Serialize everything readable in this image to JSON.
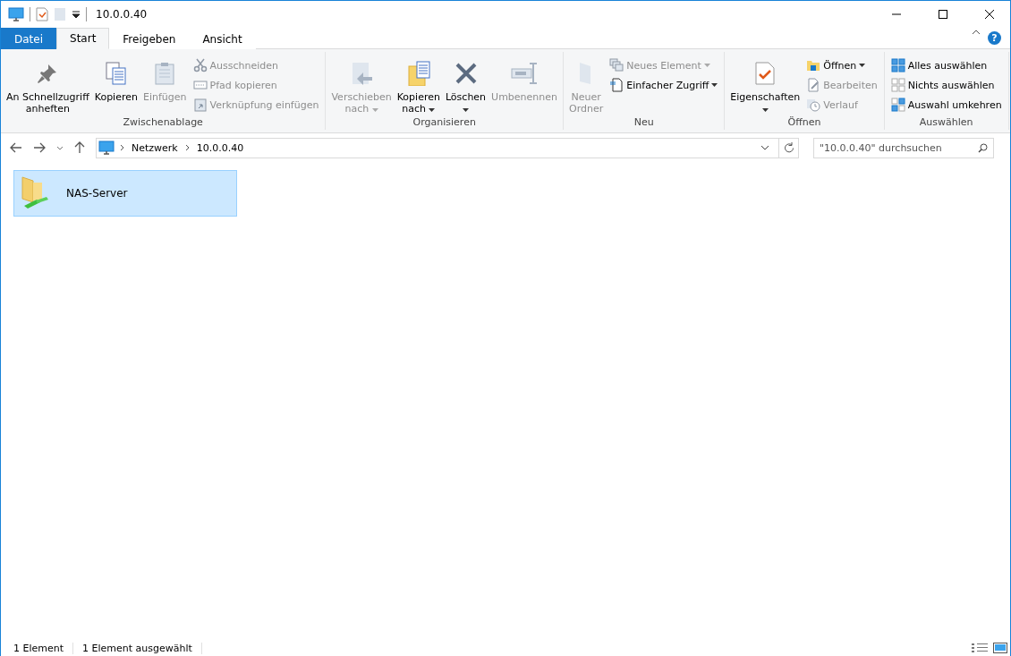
{
  "window": {
    "title": "10.0.0.40"
  },
  "tabs": [
    {
      "label": "Datei",
      "kind": "file",
      "selected": false
    },
    {
      "label": "Start",
      "kind": "tab",
      "selected": true
    },
    {
      "label": "Freigeben",
      "kind": "tab",
      "selected": false
    },
    {
      "label": "Ansicht",
      "kind": "tab",
      "selected": false
    }
  ],
  "help": "?",
  "ribbon": [
    {
      "label": "Zwischenablage",
      "items": [
        {
          "kind": "large",
          "lines": [
            "An Schnellzugriff",
            "anheften"
          ],
          "disabled": false,
          "dropdown": false
        },
        {
          "kind": "large",
          "lines": [
            "Kopieren"
          ],
          "disabled": false,
          "dropdown": false
        },
        {
          "kind": "large",
          "lines": [
            "Einfügen"
          ],
          "disabled": true,
          "dropdown": false
        },
        {
          "kind": "stack",
          "items": [
            {
              "label": "Ausschneiden",
              "disabled": true,
              "dropdown": false
            },
            {
              "label": "Pfad kopieren",
              "disabled": true,
              "dropdown": false
            },
            {
              "label": "Verknüpfung einfügen",
              "disabled": true,
              "dropdown": false
            }
          ]
        }
      ]
    },
    {
      "label": "Organisieren",
      "items": [
        {
          "kind": "large",
          "lines": [
            "Verschieben",
            "nach"
          ],
          "disabled": true,
          "dropdown": true
        },
        {
          "kind": "large",
          "lines": [
            "Kopieren",
            "nach"
          ],
          "disabled": false,
          "dropdown": true
        },
        {
          "kind": "large",
          "lines": [
            "Löschen"
          ],
          "disabled": false,
          "dropdown": true
        },
        {
          "kind": "large",
          "lines": [
            "Umbenennen"
          ],
          "disabled": true,
          "dropdown": false
        }
      ]
    },
    {
      "label": "Neu",
      "items": [
        {
          "kind": "large",
          "lines": [
            "Neuer",
            "Ordner"
          ],
          "disabled": true,
          "dropdown": false
        },
        {
          "kind": "stack",
          "items": [
            {
              "label": "Neues Element",
              "disabled": true,
              "dropdown": true
            },
            {
              "label": "Einfacher Zugriff",
              "disabled": false,
              "dropdown": true
            }
          ]
        }
      ]
    },
    {
      "label": "Öffnen",
      "items": [
        {
          "kind": "large",
          "lines": [
            "Eigenschaften"
          ],
          "disabled": false,
          "dropdown": true
        },
        {
          "kind": "stack",
          "items": [
            {
              "label": "Öffnen",
              "disabled": false,
              "dropdown": true
            },
            {
              "label": "Bearbeiten",
              "disabled": true,
              "dropdown": false
            },
            {
              "label": "Verlauf",
              "disabled": true,
              "dropdown": false
            }
          ]
        }
      ]
    },
    {
      "label": "Auswählen",
      "items": [
        {
          "kind": "stack",
          "items": [
            {
              "label": "Alles auswählen",
              "disabled": false,
              "dropdown": false
            },
            {
              "label": "Nichts auswählen",
              "disabled": false,
              "dropdown": false
            },
            {
              "label": "Auswahl umkehren",
              "disabled": false,
              "dropdown": false
            }
          ]
        }
      ]
    }
  ],
  "address": {
    "path": [
      "Netzwerk",
      "10.0.0.40"
    ]
  },
  "search": {
    "placeholder": "\"10.0.0.40\" durchsuchen"
  },
  "items": [
    {
      "name": "NAS-Server",
      "selected": true
    }
  ],
  "status_bar": [
    "1 Element",
    "1 Element ausgewählt"
  ]
}
